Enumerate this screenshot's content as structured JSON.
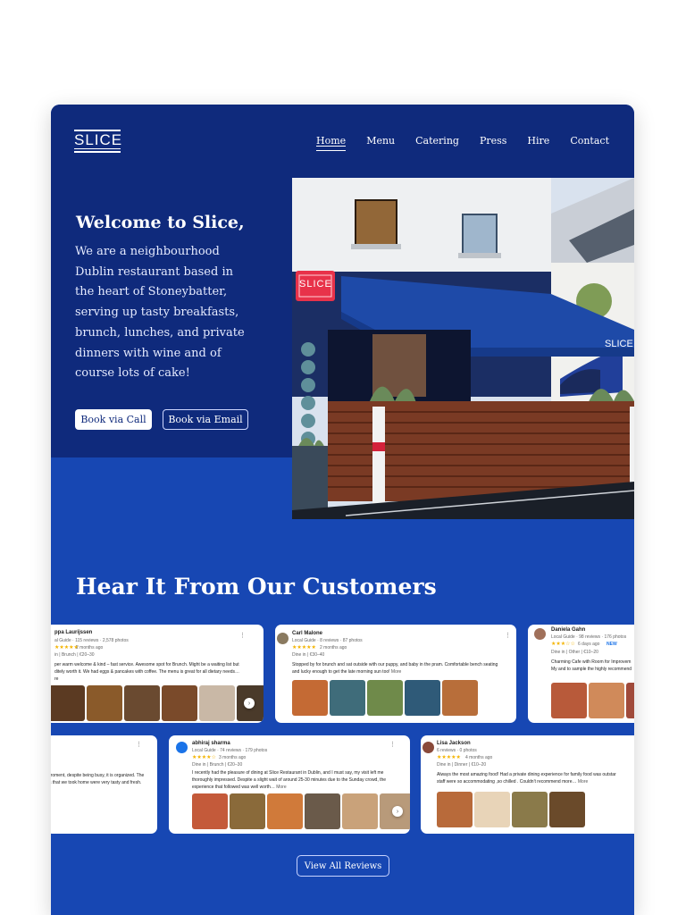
{
  "brand": {
    "logo_text": "SLICE"
  },
  "nav": [
    "Home",
    "Menu",
    "Catering",
    "Press",
    "Hire",
    "Contact"
  ],
  "hero": {
    "heading": "Welcome to Slice,",
    "intro_lines": [
      "We are a neighbourhood",
      "Dublin restaurant based in",
      "the heart of Stoneybatter,",
      "serving up tasty breakfasts,",
      "brunch, lunches, and private",
      "dinners with wine and of",
      "course lots of cake!"
    ],
    "call_label": "Book via Call",
    "email_label": "Book via Email",
    "sign_text": "SLICE",
    "wall_text": "SLICE"
  },
  "reviews_title": "Hear It From Our Customers",
  "reviews": [
    {
      "name": "ppa Laurijssen",
      "meta": "al Guide · 115 reviews · 2,578 photos",
      "stars": "★★★★★",
      "time": "2 months ago",
      "tags": "in | Brunch | €20–30",
      "text": [
        "per warm welcome & kind – fast service. Awesome spot for Brunch. Might be a waiting list but",
        "ditely worth it. We had eggs & pancakes with coffee. The menu is great for all dietary needs…",
        "re"
      ]
    },
    {
      "name": "Carl Malone",
      "meta": "Local Guide · 8 reviews · 87 photos",
      "stars": "★★★★★",
      "time": "2 months ago",
      "tags": "Dine in | €30–40",
      "text": [
        "Stopped by for brunch and sat outside with our puppy, and baby in the pram. Comfortable bench seating",
        "and lucky enough to get the late morning sun too!"
      ],
      "more": "More"
    },
    {
      "name": "Daniela Gahn",
      "meta": "Local Guide · 98 reviews · 176 photos",
      "stars": "★★★☆☆",
      "time": "6 days ago",
      "new": "NEW",
      "tags": "Dine in | Other | €10–20",
      "text": [
        "Charming Cafe with Room for Improvem",
        "",
        "My and to sample the highly recommend"
      ]
    },
    {
      "name": "",
      "meta": "",
      "stars": "",
      "time": "",
      "tags": "",
      "text": [
        "rroment, despite being busy, it is organized. The",
        "s that we took home were very tasty and fresh."
      ]
    },
    {
      "name": "abhiraj sharma",
      "meta": "Local Guide · 74 reviews · 179 photos",
      "stars": "★★★★☆",
      "time": "3 months ago",
      "tags": "Dine in | Brunch | €20–30",
      "text": [
        "I recently had the pleasure of dining at Slice Restaurant in Dublin, and I must say, my visit left me",
        "thoroughly impressed. Despite a slight wait of around 25-30 minutes due to the Sunday crowd, the",
        "experience that followed was well worth…"
      ],
      "more": "More"
    },
    {
      "name": "Lisa Jackson",
      "meta": "6 reviews · 0 photos",
      "stars": "★★★★★",
      "time": "4 months ago",
      "tags": "Dine in | Dinner | €10–20",
      "text": [
        "Always the most amazing food! Had a private dining experience for family food was outstar",
        "staff were so accommodating ,so chilled . Couldn't recommend more…"
      ],
      "more": "More"
    }
  ],
  "view_all_label": "View All Reviews",
  "colors": {
    "hero_bg": "#0f2a7c",
    "section_bg": "#1747b3",
    "awning": "#1a3d8f",
    "sign": "#e8324a",
    "stars": "#f4b400"
  }
}
